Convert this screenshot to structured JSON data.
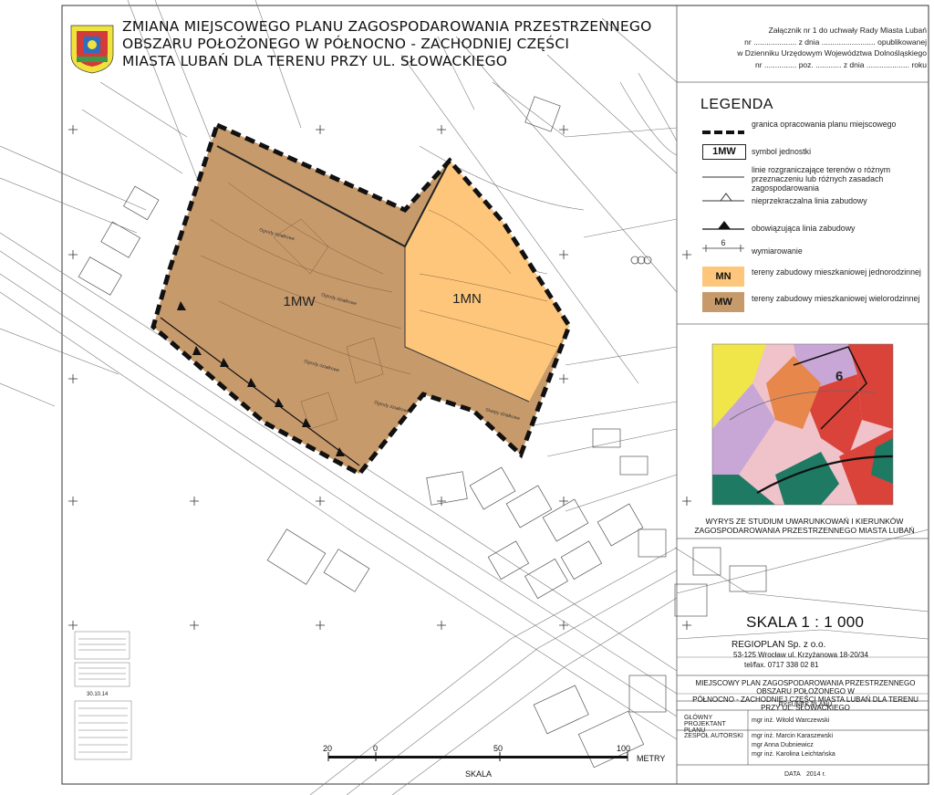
{
  "header": {
    "title_lines": [
      "ZMIANA MIEJSCOWEGO PLANU ZAGOSPODAROWANIA PRZESTRZENNEGO",
      "OBSZARU POŁOŻONEGO W PÓŁNOCNO - ZACHODNIEJ CZĘŚCI",
      "MIASTA LUBAŃ DLA TERENU PRZY UL. SŁOWACKIEGO"
    ],
    "attachment_lines": [
      "Załącznik nr 1 do uchwały Rady Miasta Lubań",
      "nr .................... z dnia ......................... opublikowanej",
      "w Dzienniku Urzędowym Województwa Dolnośląskiego",
      "nr ............... poz. ............ z dnia .................... roku"
    ]
  },
  "legend": {
    "title": "LEGENDA",
    "items": [
      {
        "symbol": "dashed-boundary",
        "text": "granica opracowania planu miejscowego"
      },
      {
        "symbol": "1MW",
        "text": "symbol jednostki"
      },
      {
        "symbol": "thin-line",
        "text": "linie rozgraniczające terenów o różnym przeznaczeniu lub różnych zasadach zagospodarowania"
      },
      {
        "symbol": "open-triangle-line",
        "text": "nieprzekraczalna linia zabudowy"
      },
      {
        "symbol": "filled-triangle-line",
        "text": "obowiązująca linia zabudowy"
      },
      {
        "symbol": "6",
        "text": "wymiarowanie"
      },
      {
        "symbol": "MN",
        "text": "tereny zabudowy mieszkaniowej jednorodzinnej",
        "color": "#fdc67a"
      },
      {
        "symbol": "MW",
        "text": "tereny zabudowy mieszkaniowej wielorodzinnej",
        "color": "#c79a6b"
      }
    ]
  },
  "map": {
    "units": [
      {
        "label": "1MW",
        "color": "#c79a6b"
      },
      {
        "label": "1MN",
        "color": "#fdc67a"
      }
    ],
    "notes": [
      "Ogrody działkowe",
      "Ogrody działkowe",
      "Ogrody działkowe",
      "Ogrody działkowe",
      "Skarpy działkowe"
    ]
  },
  "studium": {
    "caption_lines": [
      "WYRYS ZE STUDIUM UWARUNKOWAŃ I KIERUNKÓW",
      "ZAGOSPODAROWANIA PRZESTRZENNEGO MIASTA LUBAŃ"
    ],
    "label": "6",
    "colors": {
      "pink": "#f0c2c9",
      "red": "#d9433a",
      "yellow": "#f1e649",
      "teal": "#1f7a63",
      "lilac": "#c8a6d6",
      "orange": "#e7874b"
    }
  },
  "scale": {
    "text": "SKALA 1 : 1 000"
  },
  "company": {
    "name": "REGIOPLAN Sp. z o.o.",
    "address": "53-125 Wrocław ul. Krzyżanowa 18-20/34",
    "phone": "tel/fax. 0717 338 02 81"
  },
  "project": {
    "description_lines": [
      "MIEJSCOWY PLAN ZAGOSPODAROWANIA PRZESTRZENNEGO OBSZARU POŁOŻONEGO W",
      "PÓŁNOCNO - ZACHODNIEJ CZĘŚCI MIASTA LUBAŃ DLA TERENU PRZY UL. SŁOWACKIEGO"
    ],
    "drawing": "RYSUNEK PLANU",
    "chief_label": "GŁÓWNY PROJEKTANT PLANU",
    "chief_name": "mgr inż. Witold Warczewski",
    "team_label": "ZESPÓŁ AUTORSKI",
    "team": [
      "mgr inż. Marcin Karaszewski",
      "mgr Anna Dubniewicz",
      "mgr inż. Karolina Leichtańska"
    ],
    "date_label": "DATA",
    "date_value": "2014 r."
  },
  "scalebar": {
    "ticks": [
      "20",
      "0",
      "50",
      "100"
    ],
    "unit": "METRY",
    "caption": "SKALA"
  },
  "stamp": {
    "date": "30.10.14"
  }
}
